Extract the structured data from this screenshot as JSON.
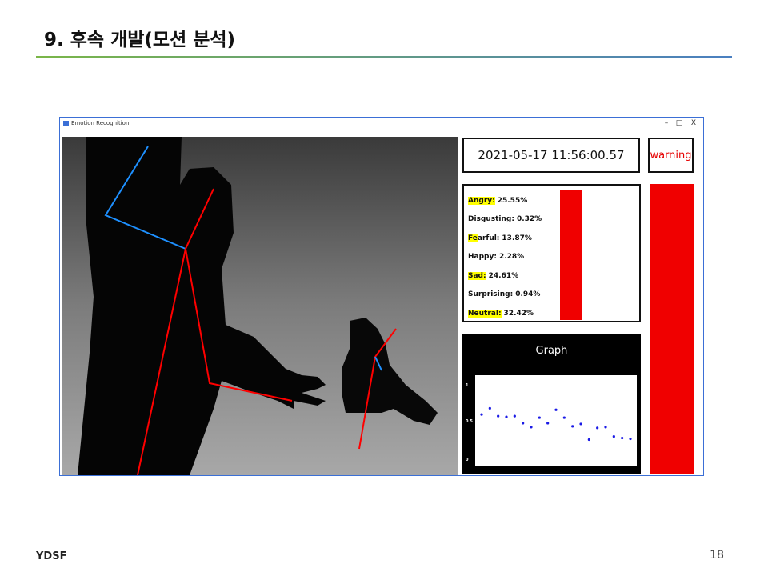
{
  "slide": {
    "title": "9. 후속 개발(모션 분석)",
    "footer_left": "YDSF",
    "page_number": "18"
  },
  "window": {
    "title": "Emotion Recognition",
    "controls": {
      "minimize": "–",
      "maximize": "□",
      "close": "X"
    }
  },
  "datetime": "2021-05-17 11:56:00.57",
  "warning_label": "warning",
  "emotions": [
    {
      "name": "Angry:",
      "value": "25.55%",
      "highlight": true
    },
    {
      "name": "Disgusting:",
      "value": "0.32%",
      "highlight": false
    },
    {
      "name": "Fearful:",
      "value": "13.87%",
      "highlight": false,
      "partial_highlight": "Fe"
    },
    {
      "name": "Happy:",
      "value": "2.28%",
      "highlight": false
    },
    {
      "name": "Sad:",
      "value": "24.61%",
      "highlight": true
    },
    {
      "name": "Surprising:",
      "value": "0.94%",
      "highlight": false
    },
    {
      "name": "Neutral:",
      "value": "32.42%",
      "highlight": true
    }
  ],
  "graph": {
    "title": "Graph",
    "y_labels": [
      "1",
      "0.5",
      "0"
    ],
    "points": [
      0.58,
      0.66,
      0.56,
      0.55,
      0.56,
      0.47,
      0.42,
      0.54,
      0.47,
      0.64,
      0.54,
      0.43,
      0.46,
      0.26,
      0.41,
      0.42,
      0.3,
      0.28,
      0.27
    ],
    "point_color": "#1a1ae6"
  },
  "colors": {
    "bar": "#f00000",
    "highlight": "#ffff00",
    "skeleton_red": "#ff0000",
    "skeleton_blue": "#1e90ff"
  }
}
